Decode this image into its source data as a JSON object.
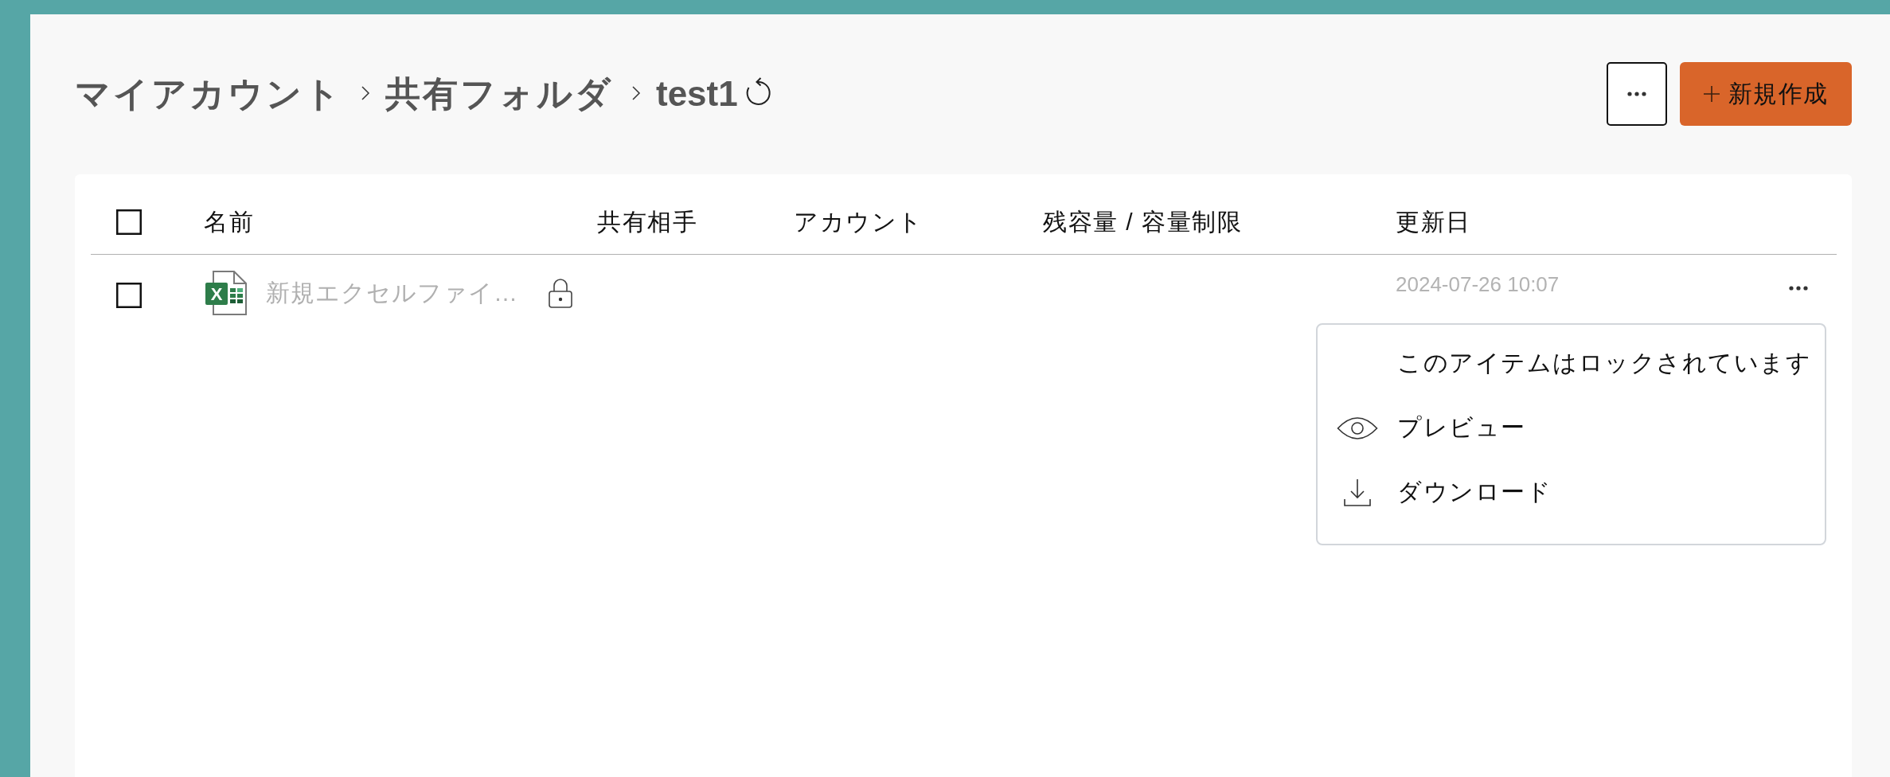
{
  "breadcrumb": [
    {
      "label": "マイアカウント"
    },
    {
      "label": "共有フォルダ"
    },
    {
      "label": "test1"
    }
  ],
  "toolbar": {
    "new_button": {
      "label": "新規作成"
    }
  },
  "table": {
    "select_all": {
      "checked": false
    },
    "columns": [
      "名前",
      "共有相手",
      "アカウント",
      "残容量 / 容量制限",
      "更新日"
    ],
    "rows": [
      {
        "checked": false,
        "kind": "excel",
        "file_icon_letter": "X",
        "name": "新規エクセルファイ…",
        "locked": true,
        "updated": "2024-07-26 10:07"
      }
    ]
  },
  "context_menu": {
    "items": [
      {
        "kind": "note",
        "label": "このアイテムはロックされています"
      },
      {
        "kind": "preview",
        "label": "プレビュー"
      },
      {
        "kind": "download",
        "label": "ダウンロード"
      }
    ]
  }
}
